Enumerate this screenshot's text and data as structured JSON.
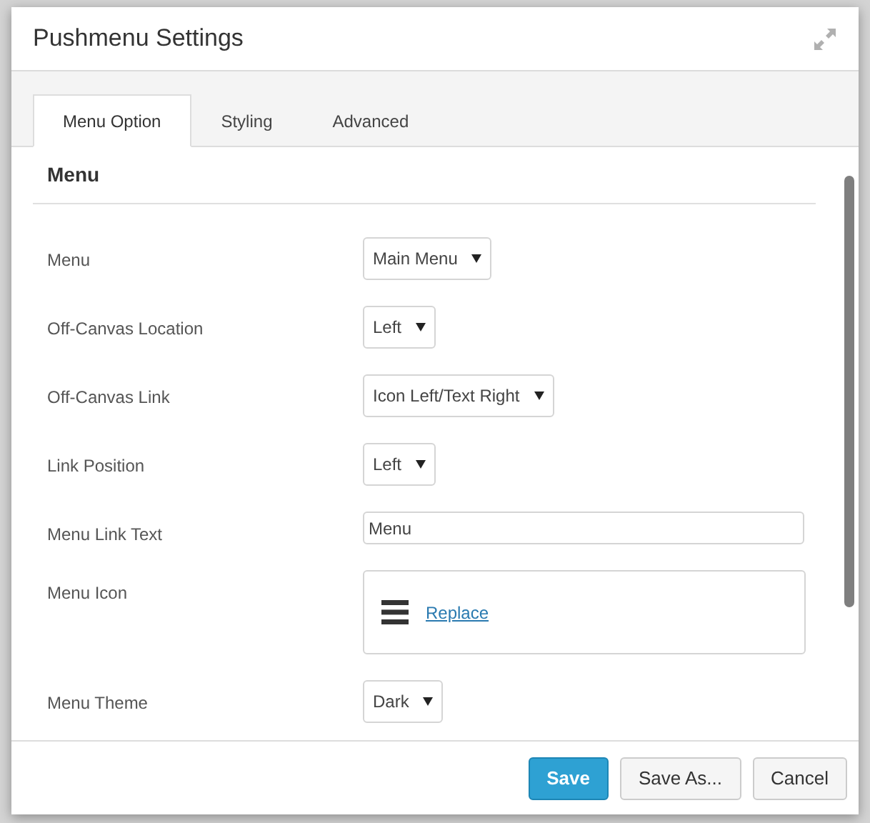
{
  "window": {
    "title": "Pushmenu Settings"
  },
  "tabs": [
    {
      "label": "Menu Option",
      "selected": true
    },
    {
      "label": "Styling",
      "selected": false
    },
    {
      "label": "Advanced",
      "selected": false
    }
  ],
  "section": {
    "title": "Menu"
  },
  "fields": [
    {
      "kind": "select",
      "label": "Menu",
      "value": "Main Menu"
    },
    {
      "kind": "select",
      "label": "Off-Canvas Location",
      "value": "Left"
    },
    {
      "kind": "select",
      "label": "Off-Canvas Link",
      "value": "Icon Left/Text Right"
    },
    {
      "kind": "select",
      "label": "Link Position",
      "value": "Left"
    },
    {
      "kind": "text",
      "label": "Menu Link Text",
      "value": "Menu"
    },
    {
      "kind": "icon",
      "label": "Menu Icon",
      "link": "Replace"
    },
    {
      "kind": "select",
      "label": "Menu Theme",
      "value": "Dark"
    }
  ],
  "buttons": [
    {
      "label": "Save",
      "primary": true
    },
    {
      "label": "Save As...",
      "primary": false
    },
    {
      "label": "Cancel",
      "primary": false
    }
  ]
}
